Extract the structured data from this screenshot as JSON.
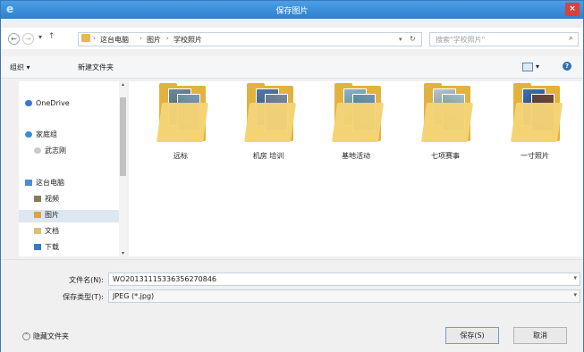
{
  "window": {
    "title": "保存图片",
    "app_icon": "e",
    "close_glyph": "×"
  },
  "address": {
    "back_glyph": "←",
    "forward_glyph": "→",
    "history_glyph": "▾",
    "up_glyph": "↑",
    "crumbs": [
      "这台电脑",
      "图片",
      "学校照片"
    ],
    "separator": "›",
    "dropdown_glyph": "▾",
    "refresh_glyph": "↻"
  },
  "search": {
    "placeholder": "搜索\"学校照片\"",
    "icon_glyph": "⌕"
  },
  "toolbar": {
    "organize": "组织 ▾",
    "new_folder": "新建文件夹",
    "view_arrow": "▾",
    "help_glyph": "?"
  },
  "nav": {
    "onedrive": "OneDrive",
    "homegroup": "家庭组",
    "homegroup_user": "武志刚",
    "this_pc": "这台电脑",
    "videos": "视频",
    "pictures": "图片",
    "documents": "文档",
    "downloads": "下载",
    "scroll_up": "▴",
    "scroll_down": "▾"
  },
  "folders": [
    {
      "label": "远标"
    },
    {
      "label": "机房 培训"
    },
    {
      "label": "基地活动"
    },
    {
      "label": "七项赛事"
    },
    {
      "label": "一寸照片"
    }
  ],
  "form": {
    "filename_label": "文件名(N):",
    "filename_value": "WO20131115336356270846",
    "filetype_label": "保存类型(T):",
    "filetype_value": "JPEG (*.jpg)",
    "dropdown_glyph": "▾"
  },
  "footer": {
    "hide_folders": "隐藏文件夹",
    "save": "保存(S)",
    "cancel": "取消"
  },
  "colors": {
    "titlebar": "#2f7fcf",
    "close": "#d9413b",
    "folder": "#e2b23f"
  }
}
